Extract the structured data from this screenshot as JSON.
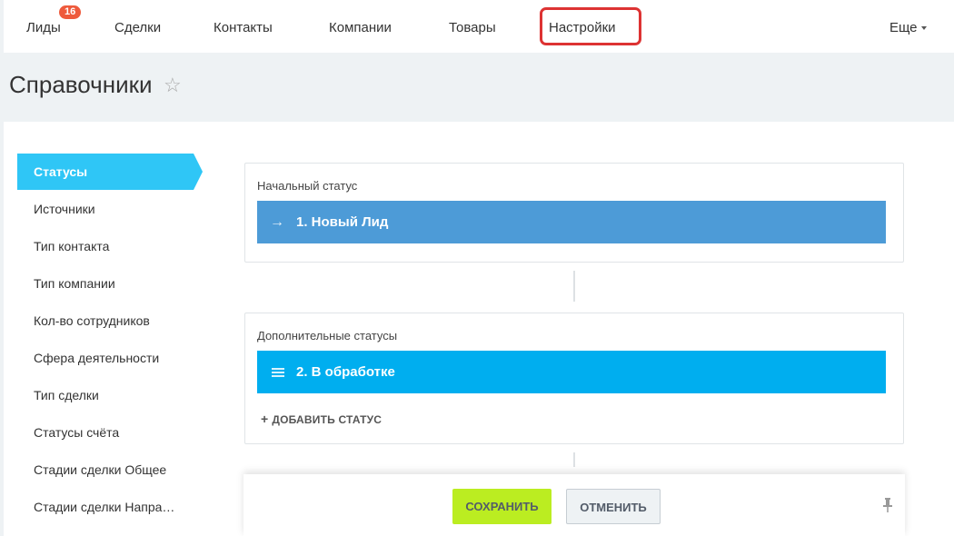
{
  "nav": {
    "leads": {
      "label": "Лиды",
      "badge": "16"
    },
    "deals": "Сделки",
    "contacts": "Контакты",
    "companies": "Компании",
    "products": "Товары",
    "settings": "Настройки",
    "more": "Еще"
  },
  "page": {
    "title": "Справочники",
    "star": "☆"
  },
  "sidebar": {
    "items": [
      {
        "label": "Статусы",
        "active": true
      },
      {
        "label": "Источники"
      },
      {
        "label": "Тип контакта"
      },
      {
        "label": "Тип компании"
      },
      {
        "label": "Кол-во сотрудников"
      },
      {
        "label": "Сфера деятельности"
      },
      {
        "label": "Тип сделки"
      },
      {
        "label": "Статусы счёта"
      },
      {
        "label": "Стадии сделки Общее"
      },
      {
        "label": "Стадии сделки Напра…"
      }
    ]
  },
  "initial": {
    "caption": "Начальный статус",
    "status": {
      "label": "1. Новый Лид",
      "color": "#4d9bd7",
      "icon": "→"
    }
  },
  "additional": {
    "caption": "Дополнительные статусы",
    "status": {
      "label": "2. В обработке",
      "color": "#00aeef"
    },
    "add_label": "ДОБАВИТЬ СТАТУС",
    "add_icon": "+"
  },
  "actions": {
    "save": "СОХРАНИТЬ",
    "cancel": "ОТМЕНИТЬ",
    "pin_icon": "pin-icon"
  },
  "colors": {
    "accent": "#2fc6f6",
    "badge": "#ee5a3c",
    "save": "#bbed21",
    "highlight": "#dd3333"
  }
}
